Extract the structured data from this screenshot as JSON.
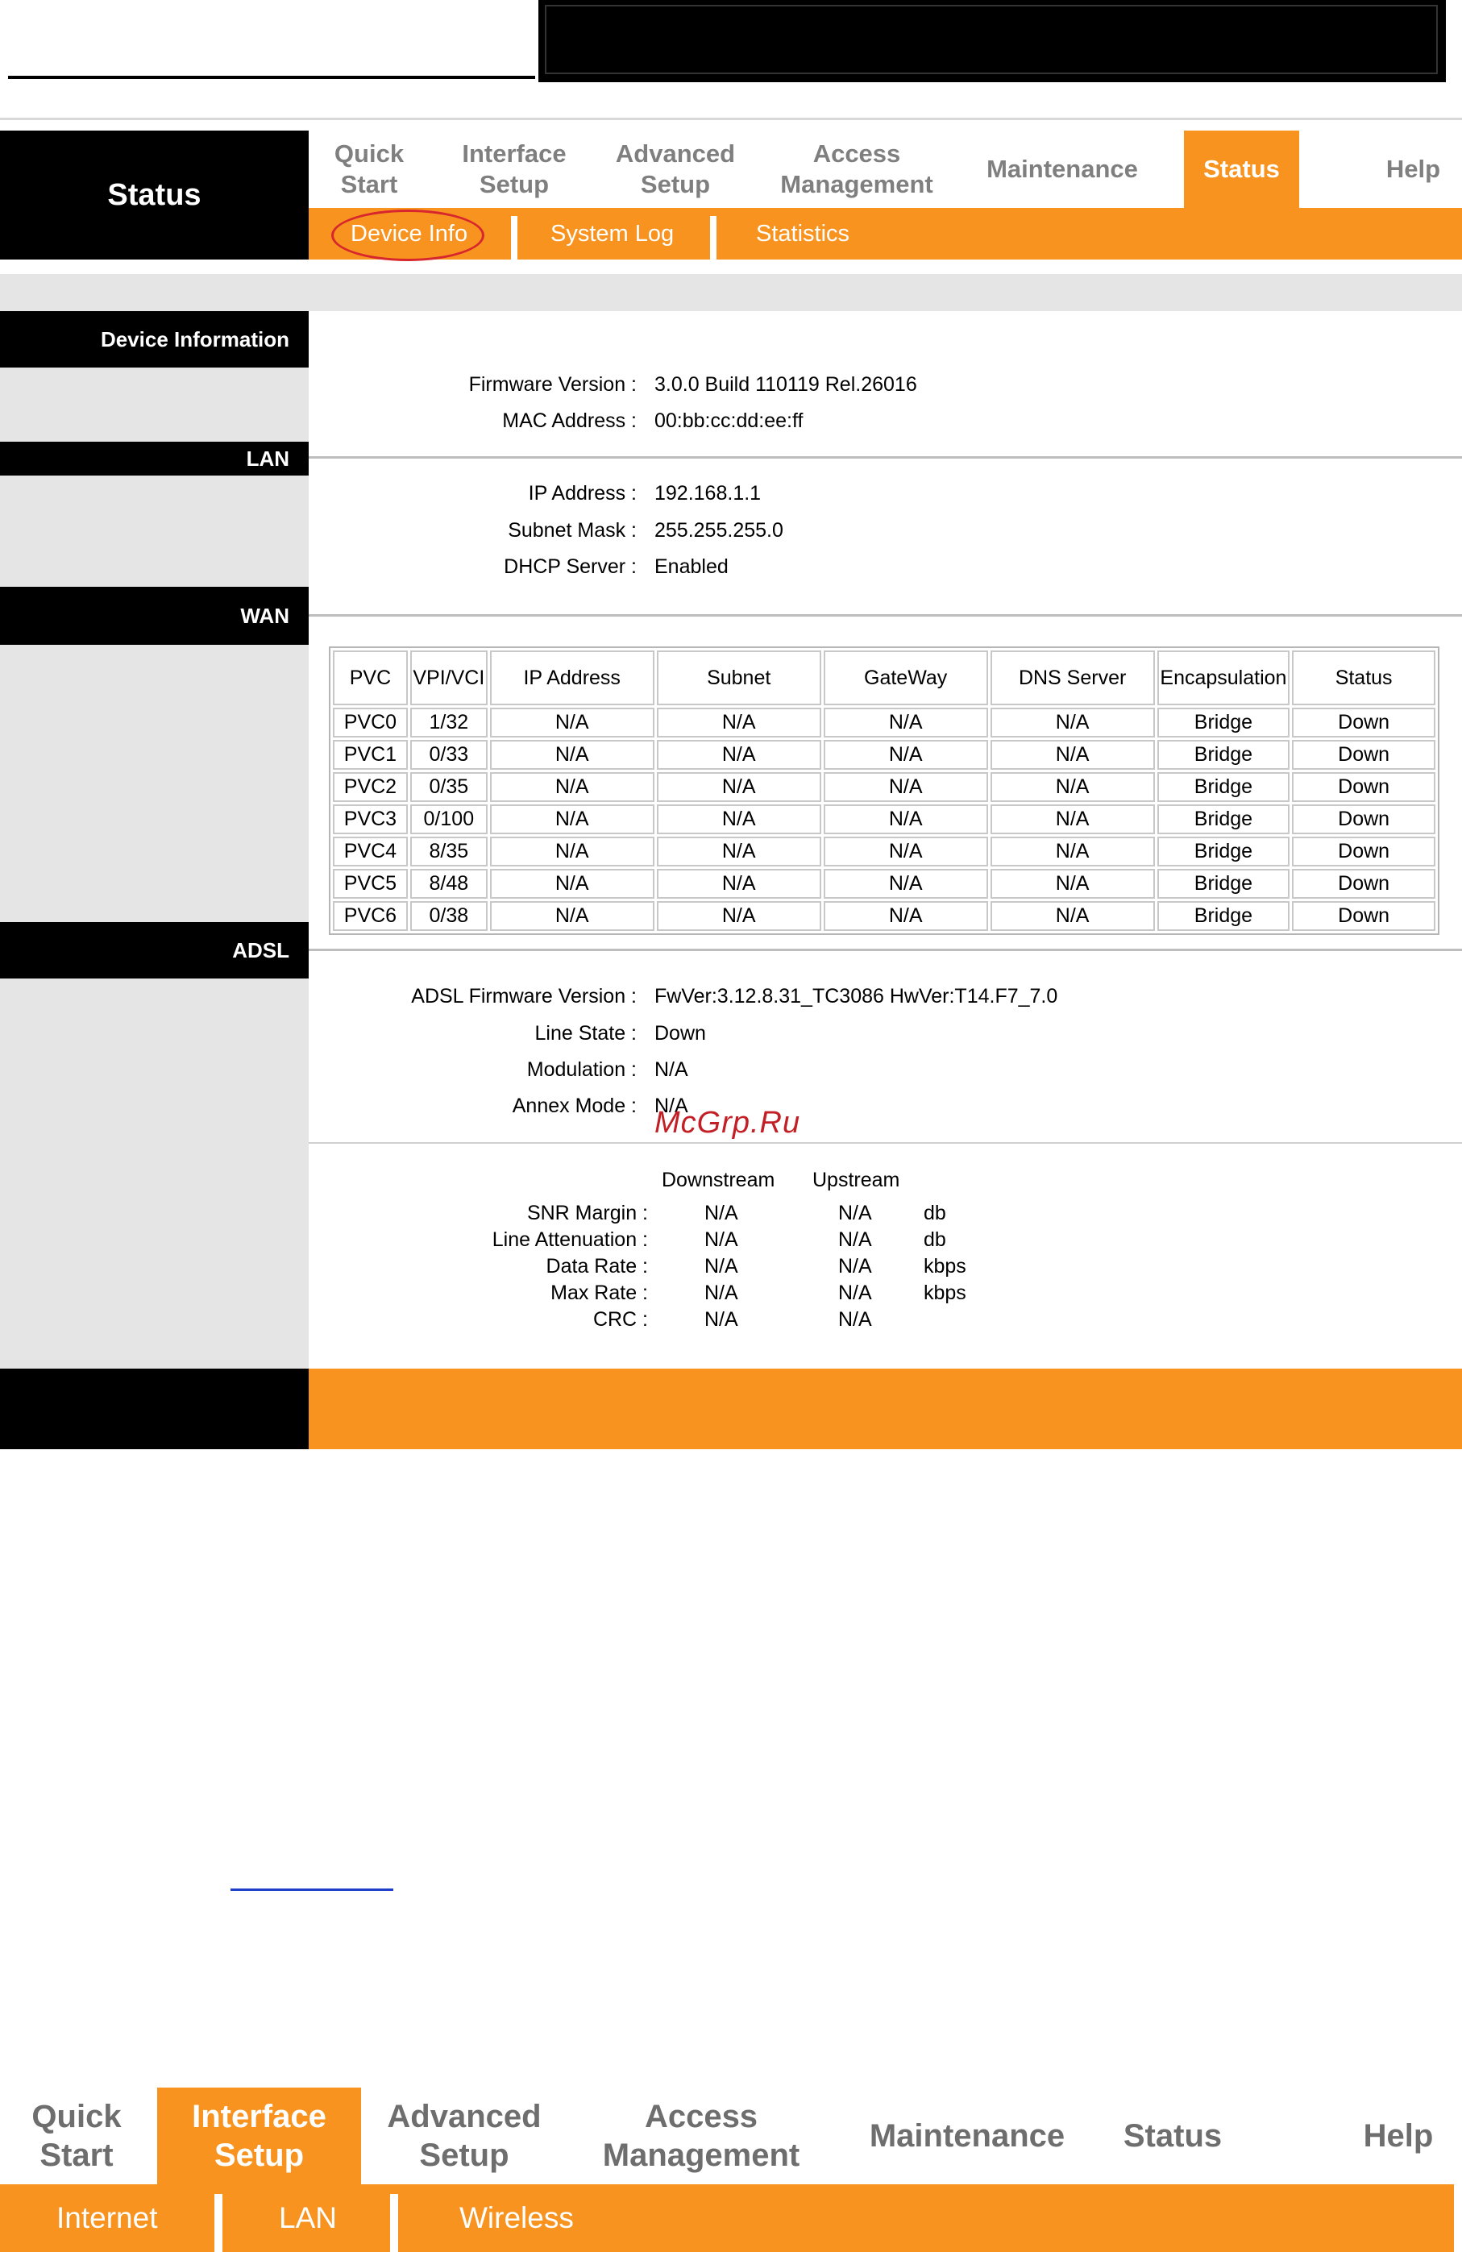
{
  "nav": {
    "side_title": "Status",
    "items": [
      {
        "label": "Quick\nStart"
      },
      {
        "label": "Interface\nSetup"
      },
      {
        "label": "Advanced\nSetup"
      },
      {
        "label": "Access\nManagement"
      },
      {
        "label": "Maintenance"
      },
      {
        "label": "Status",
        "active": true
      },
      {
        "label": "Help"
      }
    ],
    "subitems": [
      {
        "label": "Device Info",
        "highlighted": true
      },
      {
        "label": "System Log"
      },
      {
        "label": "Statistics"
      }
    ]
  },
  "device_information": {
    "section_label": "Device Information",
    "fields": [
      {
        "label": "Firmware Version :",
        "value": "3.0.0 Build 110119 Rel.26016"
      },
      {
        "label": "MAC Address :",
        "value": "00:bb:cc:dd:ee:ff"
      }
    ]
  },
  "lan": {
    "section_label": "LAN",
    "fields": [
      {
        "label": "IP Address :",
        "value": "192.168.1.1"
      },
      {
        "label": "Subnet Mask :",
        "value": "255.255.255.0"
      },
      {
        "label": "DHCP Server :",
        "value": "Enabled"
      }
    ]
  },
  "wan": {
    "section_label": "WAN",
    "columns": [
      "PVC",
      "VPI/VCI",
      "IP Address",
      "Subnet",
      "GateWay",
      "DNS Server",
      "Encapsulation",
      "Status"
    ],
    "rows": [
      [
        "PVC0",
        "1/32",
        "N/A",
        "N/A",
        "N/A",
        "N/A",
        "Bridge",
        "Down"
      ],
      [
        "PVC1",
        "0/33",
        "N/A",
        "N/A",
        "N/A",
        "N/A",
        "Bridge",
        "Down"
      ],
      [
        "PVC2",
        "0/35",
        "N/A",
        "N/A",
        "N/A",
        "N/A",
        "Bridge",
        "Down"
      ],
      [
        "PVC3",
        "0/100",
        "N/A",
        "N/A",
        "N/A",
        "N/A",
        "Bridge",
        "Down"
      ],
      [
        "PVC4",
        "8/35",
        "N/A",
        "N/A",
        "N/A",
        "N/A",
        "Bridge",
        "Down"
      ],
      [
        "PVC5",
        "8/48",
        "N/A",
        "N/A",
        "N/A",
        "N/A",
        "Bridge",
        "Down"
      ],
      [
        "PVC6",
        "0/38",
        "N/A",
        "N/A",
        "N/A",
        "N/A",
        "Bridge",
        "Down"
      ]
    ]
  },
  "adsl": {
    "section_label": "ADSL",
    "fields": [
      {
        "label": "ADSL Firmware Version :",
        "value": "FwVer:3.12.8.31_TC3086 HwVer:T14.F7_7.0"
      },
      {
        "label": "Line State :",
        "value": "Down"
      },
      {
        "label": "Modulation :",
        "value": "N/A"
      },
      {
        "label": "Annex Mode :",
        "value": "N/A"
      }
    ],
    "stats_headers": [
      "Downstream",
      "Upstream"
    ],
    "stats": [
      {
        "label": "SNR Margin :",
        "down": "N/A",
        "up": "N/A",
        "unit": "db"
      },
      {
        "label": "Line Attenuation :",
        "down": "N/A",
        "up": "N/A",
        "unit": "db"
      },
      {
        "label": "Data Rate :",
        "down": "N/A",
        "up": "N/A",
        "unit": "kbps"
      },
      {
        "label": "Max Rate :",
        "down": "N/A",
        "up": "N/A",
        "unit": "kbps"
      },
      {
        "label": "CRC :",
        "down": "N/A",
        "up": "N/A",
        "unit": ""
      }
    ]
  },
  "watermark": "McGrp.Ru",
  "bottom_nav": {
    "items": [
      {
        "label": "Quick\nStart"
      },
      {
        "label": "Interface\nSetup",
        "active": true
      },
      {
        "label": "Advanced\nSetup"
      },
      {
        "label": "Access\nManagement"
      },
      {
        "label": "Maintenance"
      },
      {
        "label": "Status"
      },
      {
        "label": "Help"
      }
    ],
    "subitems": [
      {
        "label": "Internet"
      },
      {
        "label": "LAN"
      },
      {
        "label": "Wireless"
      }
    ]
  },
  "colors": {
    "accent_orange": "#f7931e",
    "highlight_circle": "#d8262e",
    "panel_grey": "#e5e5e5",
    "nav_text_grey": "#7f7f7f"
  }
}
